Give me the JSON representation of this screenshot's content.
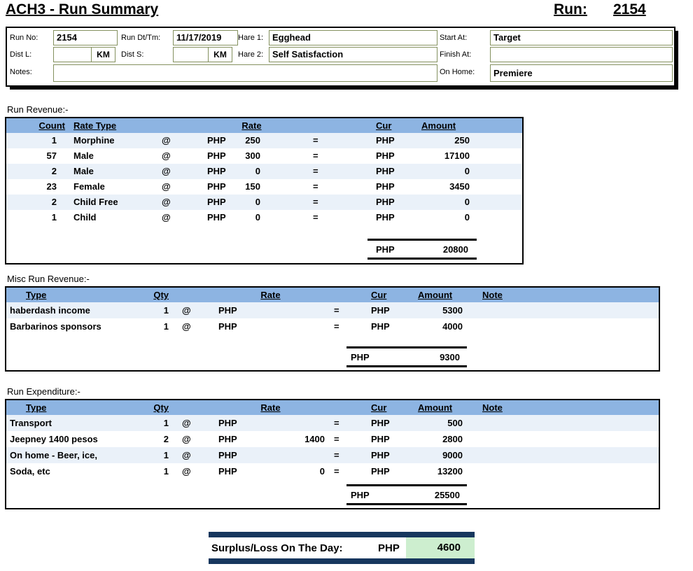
{
  "page": {
    "title": "ACH3 - Run Summary",
    "run_label": "Run:",
    "run_number": "2154"
  },
  "header": {
    "run_no": {
      "label": "Run No:",
      "value": "2154"
    },
    "run_dt": {
      "label": "Run Dt/Tm:",
      "value": "11/17/2019"
    },
    "hare1": {
      "label": "Hare 1:",
      "value": "Egghead"
    },
    "start_at": {
      "label": "Start At:",
      "value": "Target"
    },
    "dist_l": {
      "label": "Dist L:",
      "value": "",
      "unit": "KM"
    },
    "dist_s": {
      "label": "Dist S:",
      "value": "",
      "unit": "KM"
    },
    "hare2": {
      "label": "Hare 2:",
      "value": "Self Satisfaction"
    },
    "finish_at": {
      "label": "Finish At:",
      "value": ""
    },
    "notes": {
      "label": "Notes:",
      "value": ""
    },
    "on_home": {
      "label": "On Home:",
      "value": "Premiere"
    }
  },
  "run_revenue": {
    "section_label": "Run Revenue:-",
    "headers": {
      "count": "Count",
      "rate_type": "Rate Type",
      "rate": "Rate",
      "cur": "Cur",
      "amount": "Amount"
    },
    "rows": [
      {
        "count": "1",
        "type": "Morphine",
        "at": "@",
        "rate_cur": "PHP",
        "rate": "250",
        "eq": "=",
        "cur": "PHP",
        "amount": "250"
      },
      {
        "count": "57",
        "type": "Male",
        "at": "@",
        "rate_cur": "PHP",
        "rate": "300",
        "eq": "=",
        "cur": "PHP",
        "amount": "17100"
      },
      {
        "count": "2",
        "type": "Male",
        "at": "@",
        "rate_cur": "PHP",
        "rate": "0",
        "eq": "=",
        "cur": "PHP",
        "amount": "0"
      },
      {
        "count": "23",
        "type": "Female",
        "at": "@",
        "rate_cur": "PHP",
        "rate": "150",
        "eq": "=",
        "cur": "PHP",
        "amount": "3450"
      },
      {
        "count": "2",
        "type": "Child Free",
        "at": "@",
        "rate_cur": "PHP",
        "rate": "0",
        "eq": "=",
        "cur": "PHP",
        "amount": "0"
      },
      {
        "count": "1",
        "type": "Child",
        "at": "@",
        "rate_cur": "PHP",
        "rate": "0",
        "eq": "=",
        "cur": "PHP",
        "amount": "0"
      }
    ],
    "total": {
      "cur": "PHP",
      "amount": "20800"
    }
  },
  "misc_revenue": {
    "section_label": "Misc Run Revenue:-",
    "headers": {
      "type": "Type",
      "qty": "Qty",
      "rate": "Rate",
      "cur": "Cur",
      "amount": "Amount",
      "note": "Note"
    },
    "rows": [
      {
        "type": "haberdash income",
        "qty": "1",
        "at": "@",
        "rate_cur": "PHP",
        "rate": "",
        "eq": "=",
        "cur": "PHP",
        "amount": "5300",
        "note": ""
      },
      {
        "type": "Barbarinos sponsors",
        "qty": "1",
        "at": "@",
        "rate_cur": "PHP",
        "rate": "",
        "eq": "=",
        "cur": "PHP",
        "amount": "4000",
        "note": ""
      }
    ],
    "total": {
      "cur": "PHP",
      "amount": "9300"
    }
  },
  "expenditure": {
    "section_label": "Run Expenditure:-",
    "headers": {
      "type": "Type",
      "qty": "Qty",
      "rate": "Rate",
      "cur": "Cur",
      "amount": "Amount",
      "note": "Note"
    },
    "rows": [
      {
        "type": "Transport",
        "qty": "1",
        "at": "@",
        "rate_cur": "PHP",
        "rate": "",
        "eq": "=",
        "cur": "PHP",
        "amount": "500",
        "note": ""
      },
      {
        "type": "Jeepney 1400 pesos",
        "qty": "2",
        "at": "@",
        "rate_cur": "PHP",
        "rate": "1400",
        "eq": "=",
        "cur": "PHP",
        "amount": "2800",
        "note": ""
      },
      {
        "type": "On home - Beer, ice,",
        "qty": "1",
        "at": "@",
        "rate_cur": "PHP",
        "rate": "",
        "eq": "=",
        "cur": "PHP",
        "amount": "9000",
        "note": ""
      },
      {
        "type": "Soda, etc",
        "qty": "1",
        "at": "@",
        "rate_cur": "PHP",
        "rate": "0",
        "eq": "=",
        "cur": "PHP",
        "amount": "13200",
        "note": ""
      }
    ],
    "total": {
      "cur": "PHP",
      "amount": "25500"
    }
  },
  "summary": {
    "label": "Surplus/Loss On The Day:",
    "currency": "PHP",
    "amount": "4600"
  },
  "colors": {
    "table_header": "#8db4e2",
    "alt_row": "#eaf1f9",
    "navy_bar": "#17375e",
    "surplus_green": "#cdeecf",
    "field_border": "#84915f"
  }
}
